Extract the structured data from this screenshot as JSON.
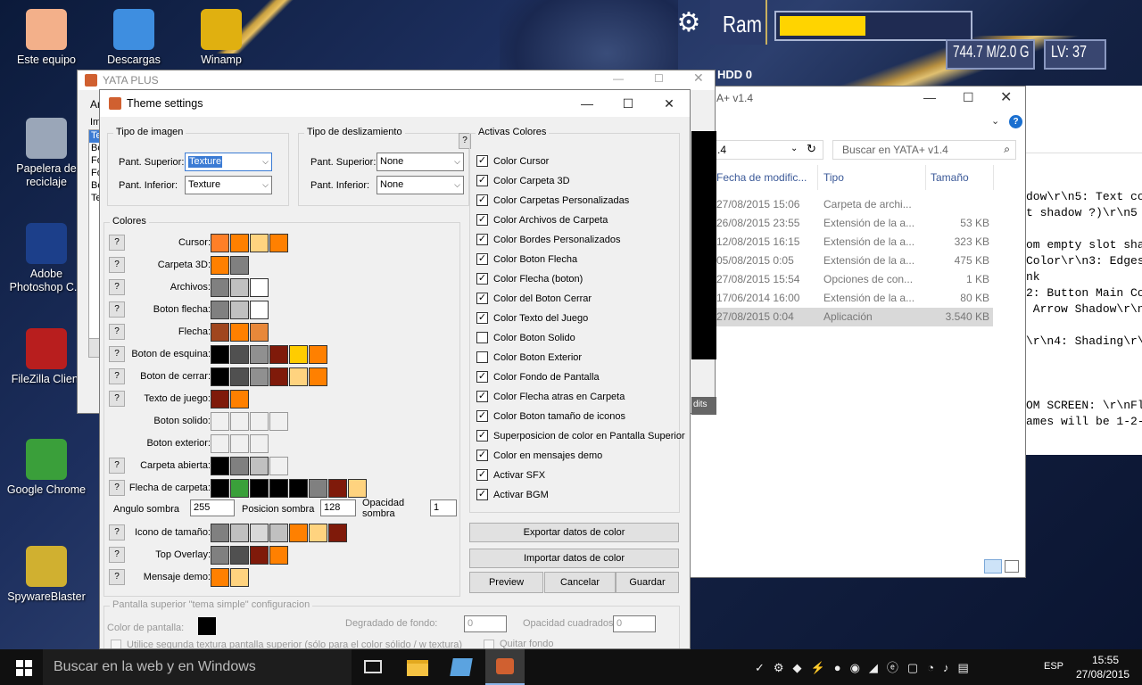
{
  "desktop": {
    "icons": [
      {
        "label": "Este equipo",
        "color": "#f3b08a"
      },
      {
        "label": "Descargas",
        "color": "#3e8ee0"
      },
      {
        "label": "Winamp",
        "color": "#e0b010"
      },
      {
        "label": "Papelera de reciclaje",
        "color": "#9aa6b8"
      },
      {
        "label": "Adobe Photoshop C...",
        "color": "#1c3f8a"
      },
      {
        "label": "FileZilla Client",
        "color": "#b81e1e"
      },
      {
        "label": "Google Chrome",
        "color": "#3a9f3a"
      },
      {
        "label": "SpywareBlaster",
        "color": "#d0b030"
      }
    ]
  },
  "ram_widget": {
    "label": "Ram",
    "usage": "744.7 M/2.0 G",
    "level": "LV: 37",
    "fill_fraction": 0.45,
    "hud_partial": "HDD 0"
  },
  "yata": {
    "title": "YATA PLUS",
    "menu": "Ar",
    "sidebar_label": "Im",
    "sidebar_items": [
      "Te",
      "Bo",
      "Fo",
      "Fo",
      "Bo",
      "Te"
    ],
    "credits_partial": "dits"
  },
  "theme": {
    "title": "Theme settings",
    "tipo_imagen": {
      "label": "Tipo de imagen",
      "sup_label": "Pant. Superior:",
      "sup_value": "Texture",
      "inf_label": "Pant. Inferior:",
      "inf_value": "Texture"
    },
    "tipo_desl": {
      "label": "Tipo de deslizamiento",
      "sup_label": "Pant. Superior:",
      "sup_value": "None",
      "inf_label": "Pant. Inferior:",
      "inf_value": "None",
      "help": "?"
    },
    "colores_label": "Colores",
    "color_rows": [
      {
        "label": "Cursor:",
        "help": true,
        "swatches": [
          "#ff7f27",
          "#ff8000",
          "#ffd37f",
          "#ff8000"
        ]
      },
      {
        "label": "Carpeta 3D:",
        "help": true,
        "swatches": [
          "#ff8000",
          "#808080"
        ]
      },
      {
        "label": "Archivos:",
        "help": true,
        "swatches": [
          "#808080",
          "#c0c0c0",
          "#ffffff"
        ]
      },
      {
        "label": "Boton flecha:",
        "help": true,
        "swatches": [
          "#808080",
          "#c0c0c0",
          "#ffffff"
        ]
      },
      {
        "label": "Flecha:",
        "help": true,
        "swatches": [
          "#a0461e",
          "#ff8000",
          "#e8883a"
        ]
      },
      {
        "label": "Boton de esquina:",
        "help": true,
        "swatches": [
          "#000000",
          "#505050",
          "#909090",
          "#7f1a0a",
          "#ffcc00",
          "#ff8000"
        ]
      },
      {
        "label": "Boton de cerrar:",
        "help": true,
        "swatches": [
          "#000000",
          "#505050",
          "#909090",
          "#7f1a0a",
          "#ffd37f",
          "#ff8000"
        ]
      },
      {
        "label": "Texto de juego:",
        "help": true,
        "swatches": [
          "#7f1a0a",
          "#ff8000"
        ]
      },
      {
        "label": "Boton solido:",
        "help": false,
        "swatches": [
          "#f0f0f0",
          "#f0f0f0",
          "#f0f0f0",
          "#f0f0f0"
        ]
      },
      {
        "label": "Boton exterior:",
        "help": false,
        "swatches": [
          "#f0f0f0",
          "#f0f0f0",
          "#f0f0f0"
        ]
      },
      {
        "label": "Carpeta abierta:",
        "help": true,
        "swatches": [
          "#000000",
          "#808080",
          "#c0c0c0",
          "#f0f0f0"
        ]
      },
      {
        "label": "Flecha de carpeta:",
        "help": true,
        "swatches": [
          "#000000",
          "#3aa03a",
          "#000000",
          "#000000",
          "#000000",
          "#808080",
          "#7f1a0a",
          "#ffd37f"
        ]
      }
    ],
    "angulo_label": "Angulo sombra",
    "angulo_value": "255",
    "posicion_label": "Posicion sombra",
    "posicion_value": "128",
    "opacidad_label": "Opacidad sombra",
    "opacidad_value": "1",
    "color_rows2": [
      {
        "label": "Icono de tamaño:",
        "help": true,
        "swatches": [
          "#808080",
          "#c0c0c0",
          "#d8d8d8",
          "#c0c0c0",
          "#ff8000",
          "#ffd37f",
          "#7f1a0a"
        ]
      },
      {
        "label": "Top Overlay:",
        "help": true,
        "swatches": [
          "#808080",
          "#505050",
          "#7f1a0a",
          "#ff8000"
        ]
      },
      {
        "label": "Mensaje demo:",
        "help": true,
        "swatches": [
          "#ff8000",
          "#ffd37f"
        ]
      }
    ],
    "activas_label": "Activas Colores",
    "checks": [
      {
        "label": "Color Cursor",
        "checked": true
      },
      {
        "label": "Color Carpeta 3D",
        "checked": true
      },
      {
        "label": "Color Carpetas Personalizadas",
        "checked": true
      },
      {
        "label": "Color Archivos de Carpeta",
        "checked": true
      },
      {
        "label": "Color Bordes Personalizados",
        "checked": true
      },
      {
        "label": "Color Boton Flecha",
        "checked": true
      },
      {
        "label": "Color Flecha (boton)",
        "checked": true
      },
      {
        "label": "Color del Boton Cerrar",
        "checked": true
      },
      {
        "label": "Color Texto del Juego",
        "checked": true
      },
      {
        "label": "Color Boton Solido",
        "checked": false
      },
      {
        "label": "Color Boton Exterior",
        "checked": false
      },
      {
        "label": "Color Fondo de Pantalla",
        "checked": true
      },
      {
        "label": "Color Flecha atras en Carpeta",
        "checked": true
      },
      {
        "label": "Color Boton tamaño de iconos",
        "checked": true
      },
      {
        "label": "Superposicion de color en Pantalla Superior",
        "checked": true
      },
      {
        "label": "Color en mensajes demo",
        "checked": true
      },
      {
        "label": "Activar SFX",
        "checked": true
      },
      {
        "label": "Activar BGM",
        "checked": true
      }
    ],
    "export_label": "Exportar datos de color",
    "import_label": "Importar datos de color",
    "preview_label": "Preview",
    "cancel_label": "Cancelar",
    "save_label": "Guardar",
    "simple": {
      "label": "Pantalla superior \"tema simple\" configuracion",
      "color_label": "Color de pantalla:",
      "degradado_label": "Degradado de fondo:",
      "degradado_value": "0",
      "opacidad_label": "Opacidad cuadrados",
      "opacidad_value": "0",
      "segunda_label": "Utilice segunda textura pantalla superior (sólo para el color sólido / w textura)",
      "quitar_label": "Quitar fondo"
    }
  },
  "explorer": {
    "title": "A+ v1.4",
    "path": ".4",
    "search_placeholder": "Buscar en YATA+ v1.4",
    "columns": [
      "Fecha de modific...",
      "Tipo",
      "Tamaño"
    ],
    "rows": [
      {
        "date": "27/08/2015 15:06",
        "type": "Carpeta de archi...",
        "size": ""
      },
      {
        "date": "26/08/2015 23:55",
        "type": "Extensión de la a...",
        "size": "53 KB"
      },
      {
        "date": "12/08/2015 16:15",
        "type": "Extensión de la a...",
        "size": "323 KB"
      },
      {
        "date": "05/08/2015 0:05",
        "type": "Extensión de la a...",
        "size": "475 KB"
      },
      {
        "date": "27/08/2015 15:54",
        "type": "Opciones de con...",
        "size": "1 KB"
      },
      {
        "date": "17/06/2014 16:00",
        "type": "Extensión de la a...",
        "size": "80 KB"
      },
      {
        "date": "27/08/2015 0:04",
        "type": "Aplicación",
        "size": "3.540 KB"
      }
    ]
  },
  "notepad": {
    "lines": [
      "dow\\r\\n5: Text co",
      "t shadow ?)\\r\\n5",
      "",
      "om empty slot sha",
      "Color\\r\\n3: Edges",
      "nk",
      "2: Button Main Co",
      " Arrow Shadow\\r\\n",
      "",
      "\\r\\n4: Shading\\r\\",
      "",
      "",
      "",
      "OM SCREEN: \\r\\nFl",
      "ames will be 1-2-"
    ]
  },
  "taskbar": {
    "search_placeholder": "Buscar en la web y en Windows",
    "lang": "ESP",
    "time": "15:55",
    "date": "27/08/2015"
  }
}
